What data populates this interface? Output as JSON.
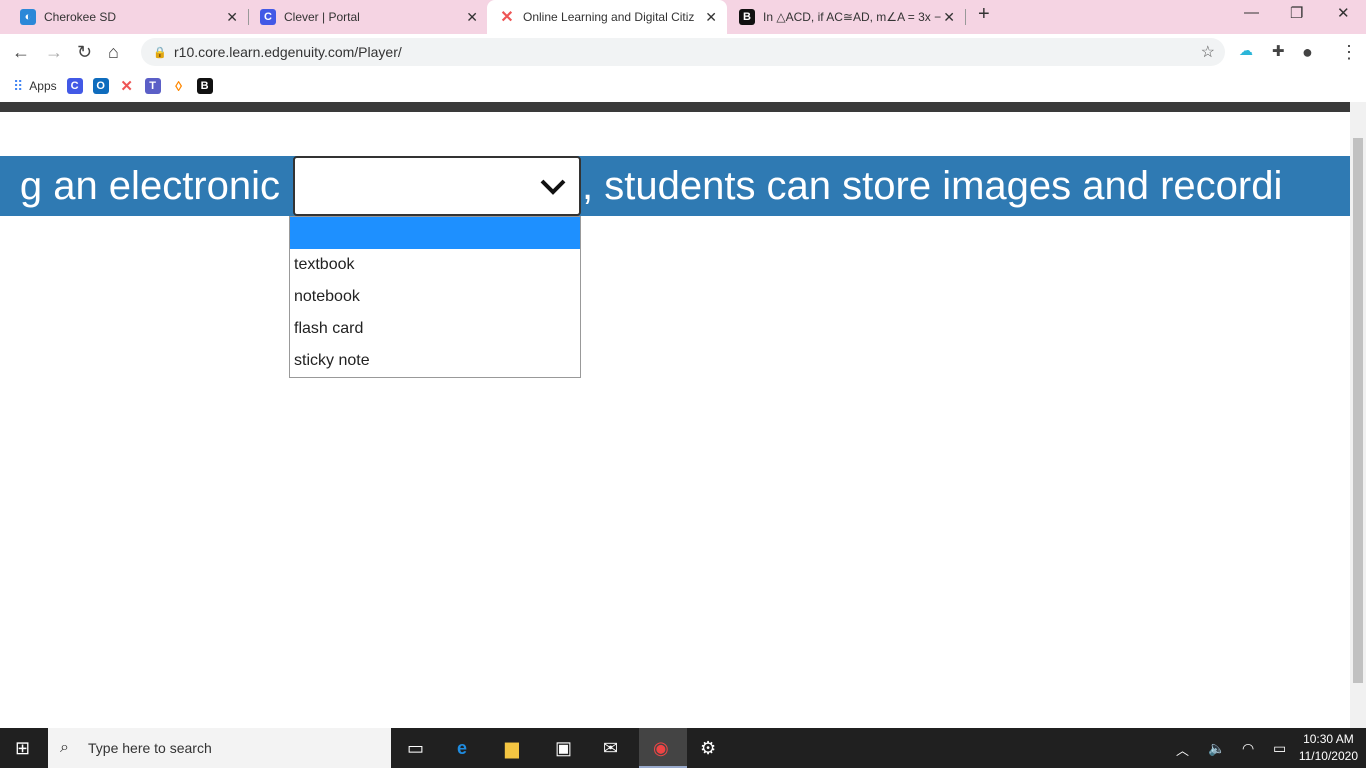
{
  "tabs": [
    {
      "title": "Cherokee SD",
      "icon": "cherokee-icon",
      "color": "#2b88d8"
    },
    {
      "title": "Clever | Portal",
      "icon": "clever-icon",
      "color": "#4259e6"
    },
    {
      "title": "Online Learning and Digital Citiz",
      "icon": "edgenuity-icon",
      "color": "#e55"
    },
    {
      "title": "In △ACD, if AC≅AD, m∠A = 3x −",
      "icon": "brainly-icon",
      "color": "#111"
    }
  ],
  "address": "r10.core.learn.edgenuity.com/Player/",
  "bookmarks": {
    "apps_label": "Apps"
  },
  "question": {
    "before": "g an electronic",
    "after": ", students can store images and recordi"
  },
  "dropdown": {
    "selected": "",
    "options": [
      "",
      "textbook",
      "notebook",
      "flash card",
      "sticky note"
    ]
  },
  "taskbar": {
    "search_placeholder": "Type here to search",
    "time": "10:30 AM",
    "date": "11/10/2020"
  }
}
